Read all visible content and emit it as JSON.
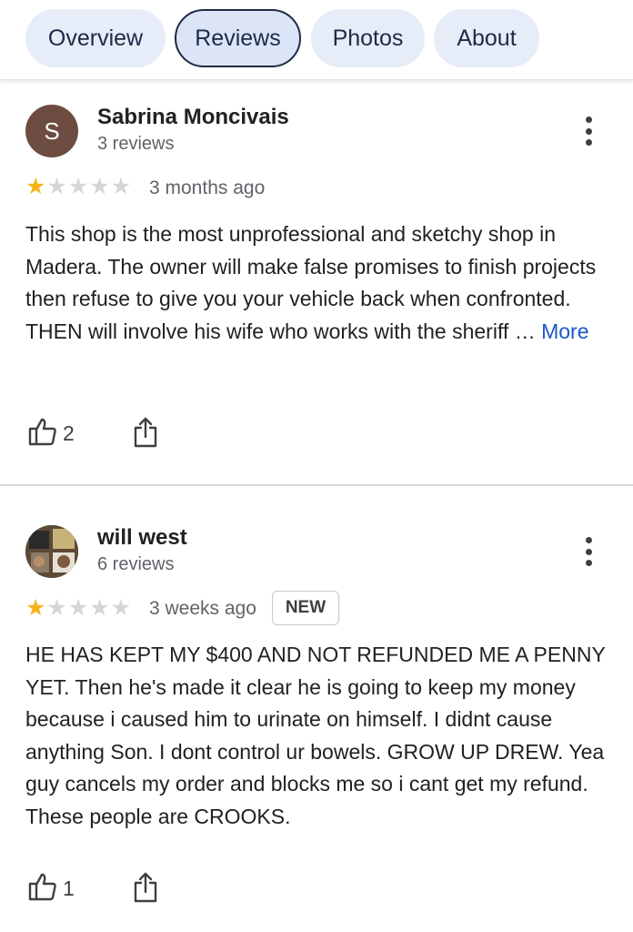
{
  "tabs": [
    {
      "label": "Overview"
    },
    {
      "label": "Reviews"
    },
    {
      "label": "Photos"
    },
    {
      "label": "About"
    }
  ],
  "reviews": [
    {
      "avatar_letter": "S",
      "name": "Sabrina Moncivais",
      "review_count": "3 reviews",
      "rating": 1,
      "date": "3 months ago",
      "text": "This shop is the most unprofessional and sketchy shop in Madera. The owner will make false promises to finish projects then refuse to give you your vehicle back when confronted. THEN will involve his wife who works with the sheriff …",
      "more_label": "More",
      "likes": "2"
    },
    {
      "name": "will west",
      "review_count": "6 reviews",
      "rating": 1,
      "date": "3 weeks ago",
      "badge": "NEW",
      "text": "HE HAS KEPT MY $400 AND NOT REFUNDED ME A PENNY YET. Then he's made it clear he is going to keep my money because i caused him to urinate on himself. I didnt cause anything Son. I dont control ur bowels. GROW UP DREW. Yea guy cancels my order and blocks me so i cant get my refund. These people are CROOKS.",
      "likes": "1"
    }
  ],
  "colors": {
    "star_filled": "#f5b41a",
    "star_empty": "#d6d6d6",
    "link": "#1a57c7",
    "tab_bg": "#e6ecf8"
  },
  "icons": [
    "thumbs-up-icon",
    "share-icon",
    "more-vert-icon",
    "star-icon"
  ]
}
